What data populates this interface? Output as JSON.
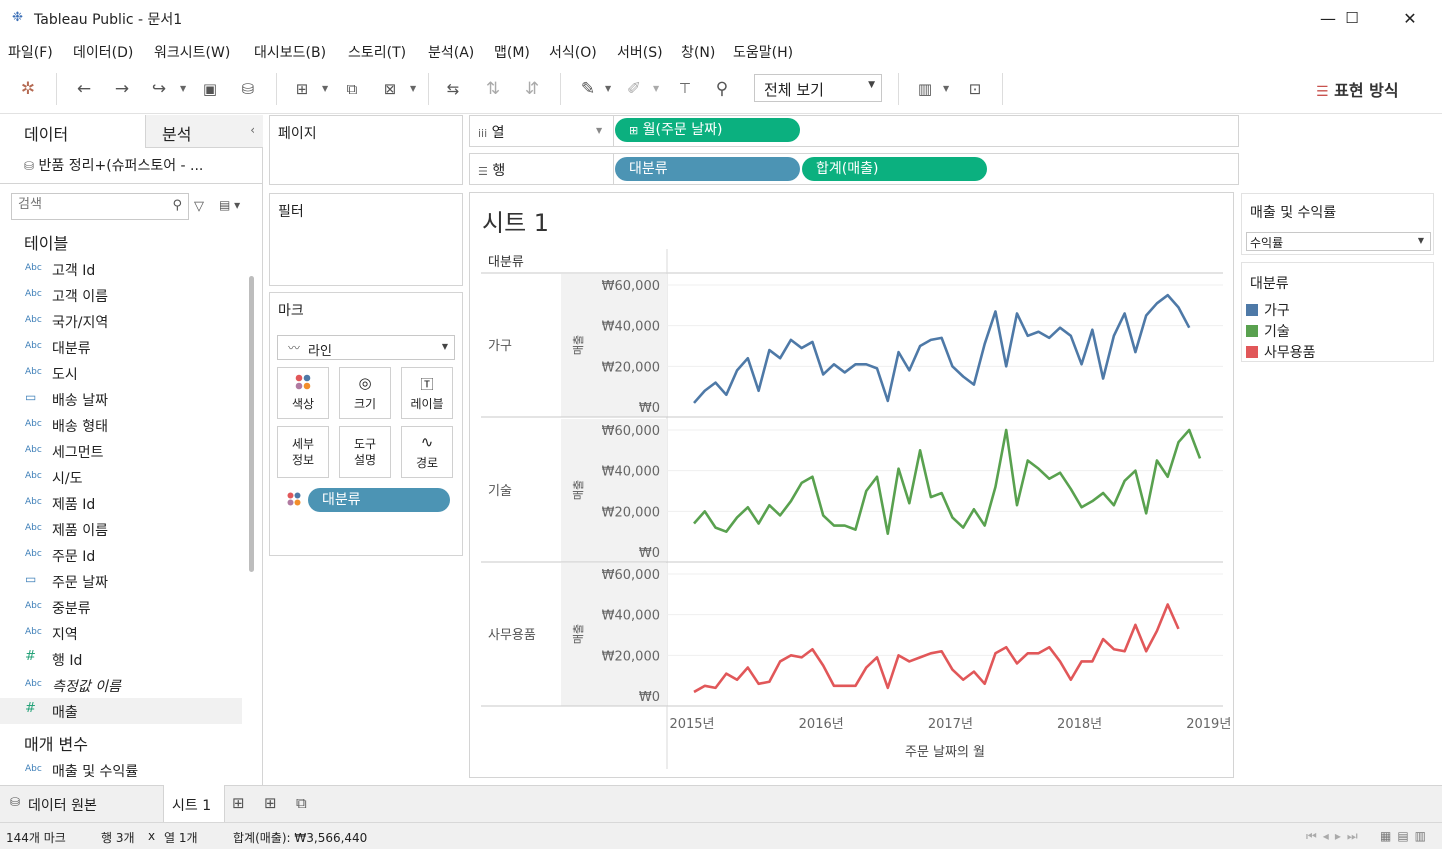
{
  "window": {
    "title": "Tableau Public - 문서1",
    "minimize_glyph": "—",
    "maximize_glyph": "☐",
    "close_glyph": "✕"
  },
  "menu": [
    "파일(F)",
    "데이터(D)",
    "워크시트(W)",
    "대시보드(B)",
    "스토리(T)",
    "분석(A)",
    "맵(M)",
    "서식(O)",
    "서버(S)",
    "창(N)",
    "도움말(H)"
  ],
  "toolbar": {
    "view_select": "전체 보기",
    "show_me": "표현 방식",
    "icons": [
      "tableau-logo-icon",
      "back-arrow-icon",
      "forward-arrow-icon",
      "redo-icon",
      "save-icon",
      "new-datasource-icon",
      "new-worksheet-icon",
      "duplicate-sheet-icon",
      "clear-sheet-icon",
      "swap-icon",
      "sort-ascending-icon",
      "sort-descending-icon",
      "highlight-icon",
      "annotate-icon",
      "text-label-icon",
      "pin-icon",
      "show-cards-icon",
      "presentation-icon"
    ]
  },
  "data_pane": {
    "tab_data": "데이터",
    "tab_analysis": "분석",
    "datasource": "반품 정리+(슈퍼스토어 - ...",
    "search_placeholder": "검색",
    "tables_header": "테이블",
    "fields": [
      {
        "type": "Abc",
        "name": "고객 Id"
      },
      {
        "type": "Abc",
        "name": "고객 이름"
      },
      {
        "type": "Abc",
        "name": "국가/지역"
      },
      {
        "type": "Abc",
        "name": "대분류"
      },
      {
        "type": "Abc",
        "name": "도시"
      },
      {
        "type": "date",
        "name": "배송 날짜"
      },
      {
        "type": "Abc",
        "name": "배송 형태"
      },
      {
        "type": "Abc",
        "name": "세그먼트"
      },
      {
        "type": "Abc",
        "name": "시/도"
      },
      {
        "type": "Abc",
        "name": "제품 Id"
      },
      {
        "type": "Abc",
        "name": "제품 이름"
      },
      {
        "type": "Abc",
        "name": "주문 Id"
      },
      {
        "type": "date",
        "name": "주문 날짜"
      },
      {
        "type": "Abc",
        "name": "중분류"
      },
      {
        "type": "Abc",
        "name": "지역"
      },
      {
        "type": "#",
        "name": "행 Id"
      },
      {
        "type": "Abc",
        "name": "측정값 이름"
      },
      {
        "type": "#",
        "name": "매출"
      }
    ],
    "params_header": "매개 변수",
    "params": [
      {
        "type": "Abc",
        "name": "매출 및 수익률"
      }
    ]
  },
  "cards": {
    "pages": "페이지",
    "filters": "필터",
    "marks": "마크",
    "mark_type": "라인",
    "buttons": [
      {
        "label": "색상"
      },
      {
        "label": "크기"
      },
      {
        "label": "레이블"
      },
      {
        "label": "세부\n정보"
      },
      {
        "label": "도구\n설명"
      },
      {
        "label": "경로"
      }
    ],
    "color_pill": "대분류"
  },
  "shelves": {
    "columns_label": "열",
    "rows_label": "행",
    "column_pills": [
      "월(주문 날짜)"
    ],
    "row_pills": [
      "대분류",
      "합계(매출)"
    ]
  },
  "legends": {
    "param_title": "매출 및 수익률",
    "param_value": "수익률",
    "color_title": "대분류",
    "items": [
      {
        "name": "가구",
        "color": "#4e79a7"
      },
      {
        "name": "기술",
        "color": "#59a14f"
      },
      {
        "name": "사무용품",
        "color": "#e15759"
      }
    ]
  },
  "bottom_tabs": {
    "datasource": "데이터 원본",
    "sheet": "시트 1"
  },
  "status": {
    "marks": "144개 마크",
    "rows": "행 3개",
    "x": "x",
    "cols": "열 1개",
    "sum": "합계(매출): ₩3,566,440"
  },
  "chart_data": {
    "type": "line",
    "title": "시트 1",
    "row_header": "대분류",
    "xlabel": "주문 날짜의 월",
    "ylabel": "매출",
    "x_ticks": [
      "2015년",
      "2016년",
      "2017년",
      "2018년",
      "2019년"
    ],
    "y_ticks": [
      "₩0",
      "₩20,000",
      "₩40,000",
      "₩60,000"
    ],
    "ylim": [
      0,
      60000
    ],
    "x_start": "2015-01",
    "panels": [
      {
        "category": "가구",
        "color": "#4e79a7",
        "values": [
          2000,
          8000,
          12000,
          6000,
          18000,
          24000,
          8000,
          28000,
          24000,
          33000,
          29000,
          32000,
          16000,
          21000,
          17000,
          21000,
          21000,
          19000,
          3000,
          27000,
          18000,
          30000,
          33000,
          34000,
          20000,
          15000,
          11000,
          31000,
          47000,
          20000,
          46000,
          35000,
          37000,
          34000,
          39000,
          35000,
          21000,
          38000,
          14000,
          35000,
          46000,
          27000,
          45000,
          51000,
          55000,
          49000,
          39000
        ]
      },
      {
        "category": "기술",
        "color": "#59a14f",
        "values": [
          14000,
          20000,
          12000,
          10000,
          17000,
          22000,
          14000,
          23000,
          18000,
          25000,
          34000,
          37000,
          18000,
          13000,
          13000,
          11000,
          30000,
          37000,
          9000,
          41000,
          24000,
          50000,
          27000,
          29000,
          17000,
          12000,
          21000,
          13000,
          32000,
          60000,
          23000,
          45000,
          41000,
          36000,
          39000,
          31000,
          22000,
          25000,
          29000,
          23000,
          35000,
          40000,
          19000,
          45000,
          37000,
          54000,
          60000,
          46000
        ]
      },
      {
        "category": "사무용품",
        "color": "#e15759",
        "values": [
          2000,
          5000,
          4000,
          11000,
          8000,
          14000,
          6000,
          7000,
          17000,
          20000,
          19000,
          23000,
          15000,
          5000,
          5000,
          5000,
          14000,
          19000,
          4000,
          20000,
          17000,
          19000,
          21000,
          22000,
          13000,
          8000,
          12000,
          6000,
          21000,
          24000,
          16000,
          21000,
          21000,
          24000,
          17000,
          8000,
          17000,
          17000,
          28000,
          23000,
          22000,
          35000,
          22000,
          32000,
          45000,
          33000
        ]
      }
    ]
  }
}
